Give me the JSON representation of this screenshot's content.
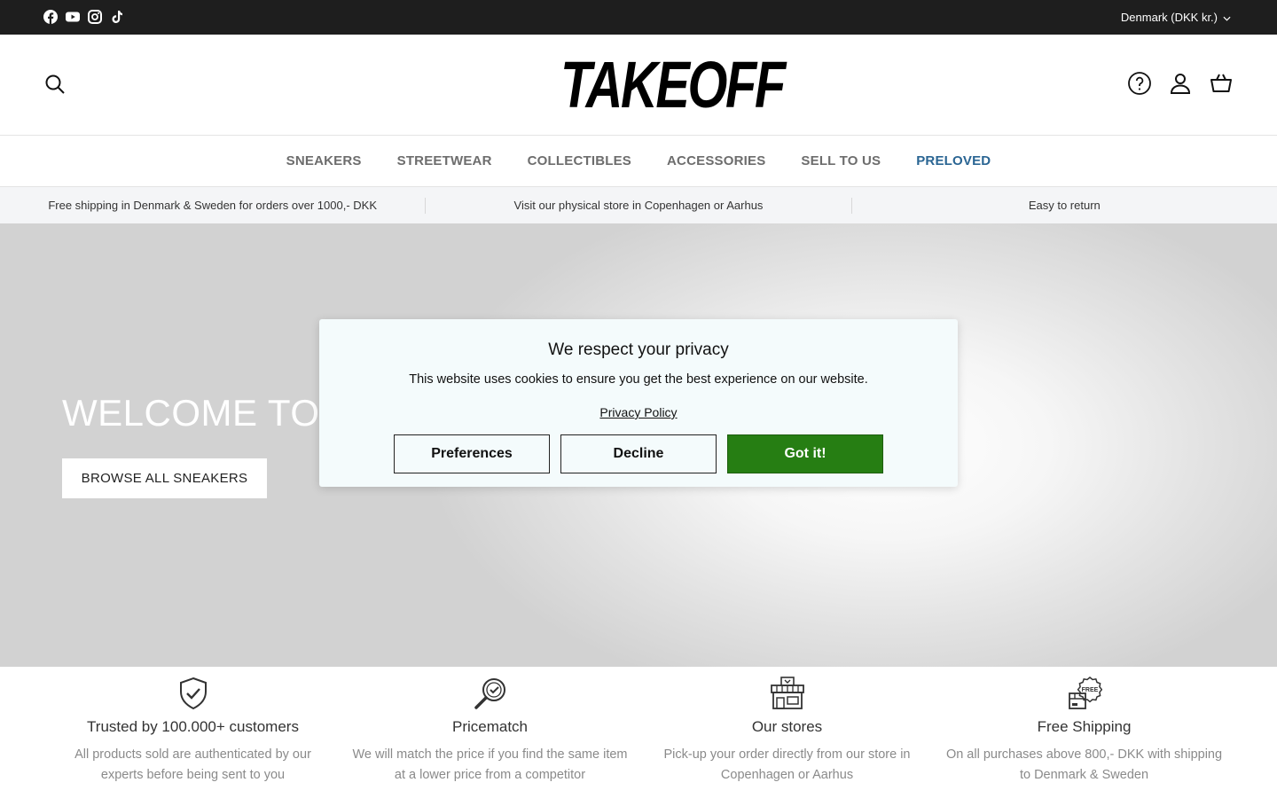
{
  "topbar": {
    "social_icons": [
      "facebook-icon",
      "youtube-icon",
      "instagram-icon",
      "tiktok-icon"
    ],
    "country_label": "Denmark (DKK kr.)"
  },
  "header": {
    "logo_text": "TAKEOFF",
    "icons": [
      "search-icon",
      "help-icon",
      "account-icon",
      "cart-icon"
    ]
  },
  "nav": {
    "items": [
      "SNEAKERS",
      "STREETWEAR",
      "COLLECTIBLES",
      "ACCESSORIES",
      "SELL TO US",
      "PRELOVED"
    ],
    "highlight_color": "#2a6593"
  },
  "usp": {
    "items": [
      "Free shipping in Denmark & Sweden for orders over 1000,- DKK",
      "Visit our physical store in Copenhagen or Aarhus",
      "Easy to return"
    ]
  },
  "hero": {
    "title": "WELCOME TO",
    "button_label": "BROWSE ALL SNEAKERS"
  },
  "cookie_modal": {
    "title": "We respect your privacy",
    "text": "This website uses cookies to ensure you get the best experience on our website.",
    "link_label": "Privacy Policy",
    "preferences_label": "Preferences",
    "decline_label": "Decline",
    "accept_label": "Got it!",
    "accept_color": "#267e13"
  },
  "features": [
    {
      "icon": "shield-check-icon",
      "title": "Trusted by 100.000+ customers",
      "desc": "All products sold are authenticated by our experts before being sent to you"
    },
    {
      "icon": "magnifier-check-icon",
      "title": "Pricematch",
      "desc": "We will match the price if you find the same item at a lower price from a competitor"
    },
    {
      "icon": "store-icon",
      "title": "Our stores",
      "desc": "Pick-up your order directly from our store in Copenhagen or Aarhus"
    },
    {
      "icon": "free-shipping-icon",
      "title": "Free Shipping",
      "desc": "On all purchases above 800,- DKK with shipping to Denmark & Sweden"
    }
  ]
}
